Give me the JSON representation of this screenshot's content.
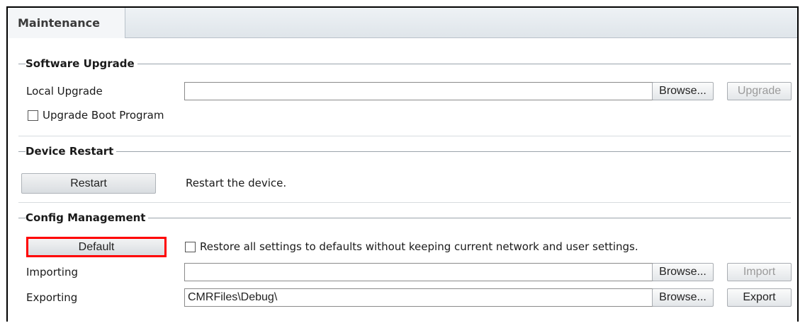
{
  "tab": {
    "label": "Maintenance"
  },
  "software_upgrade": {
    "title": "Software Upgrade",
    "local_upgrade_label": "Local Upgrade",
    "file_value": "",
    "browse_label": "Browse...",
    "upgrade_label": "Upgrade",
    "boot_checkbox_label": "Upgrade Boot Program",
    "boot_checked": false
  },
  "device_restart": {
    "title": "Device Restart",
    "restart_label": "Restart",
    "description": "Restart the device."
  },
  "config_management": {
    "title": "Config Management",
    "default_label": "Default",
    "restore_checkbox_label": "Restore all settings to defaults without keeping current network and user settings.",
    "restore_checked": false,
    "importing_label": "Importing",
    "import_path": "",
    "import_browse_label": "Browse...",
    "import_label": "Import",
    "exporting_label": "Exporting",
    "export_path": "CMRFiles\\Debug\\",
    "export_browse_label": "Browse...",
    "export_label": "Export"
  },
  "colors": {
    "highlight": "#ff0000",
    "disabled_text": "#9a9a9a"
  }
}
